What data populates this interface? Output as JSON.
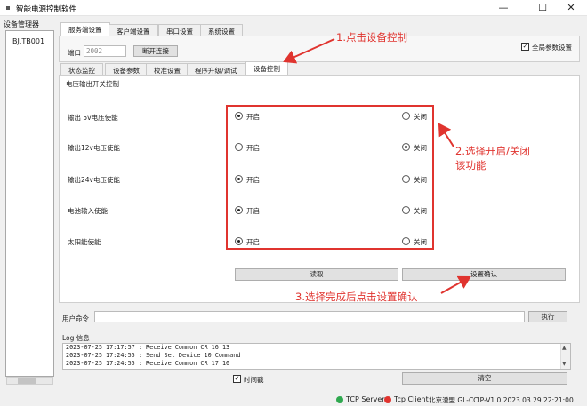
{
  "window": {
    "title": "智能电源控制软件",
    "minimize": "—",
    "maximize": "☐",
    "close": "✕"
  },
  "sidebar": {
    "title": "设备管理器",
    "devices": [
      "BJ.TB001"
    ]
  },
  "main_tabs": [
    {
      "label": "服务端设置",
      "active": true
    },
    {
      "label": "客户端设置",
      "active": false
    },
    {
      "label": "串口设置",
      "active": false
    },
    {
      "label": "系统设置",
      "active": false
    }
  ],
  "server": {
    "port_label": "端口",
    "port_value": "2002",
    "disconnect_label": "断开连接",
    "global_params_label": "全局参数设置",
    "global_params_checked": "✓"
  },
  "sub_tabs": [
    {
      "label": "状态监控",
      "active": false
    },
    {
      "label": "设备参数",
      "active": false
    },
    {
      "label": "校准设置",
      "active": false
    },
    {
      "label": "程序升级/调试",
      "active": false
    },
    {
      "label": "设备控制",
      "active": true
    }
  ],
  "control": {
    "group_title": "电压输出开关控制",
    "on_label": "开启",
    "off_label": "关闭",
    "rows": [
      {
        "label": "输出 5v电压使能",
        "state": "on"
      },
      {
        "label": "输出12v电压使能",
        "state": "off"
      },
      {
        "label": "输出24v电压使能",
        "state": "on"
      },
      {
        "label": "电池输入使能",
        "state": "on"
      },
      {
        "label": "太阳能使能",
        "state": "on"
      }
    ],
    "read_label": "读取",
    "confirm_label": "设置确认"
  },
  "command": {
    "label": "用户命令",
    "value": "",
    "execute_label": "执行"
  },
  "log": {
    "title": "Log 信息",
    "lines": [
      "2023-07-25 17:17:57 : Receive Common CR 16 13",
      "2023-07-25 17:24:55 : Send Set Device 10 Command",
      "2023-07-25 17:24:55 : Receive Common CR 17 10"
    ],
    "timestamp_label": "时间戳",
    "timestamp_checked": "✓",
    "clear_label": "清空"
  },
  "status_bar": {
    "tcp_server": "TCP Server",
    "tcp_client": "Tcp Client",
    "info": "北京澄盟 GL-CCIP-V1.0 2023.03.29 22:21:00",
    "colors": {
      "server": "#2fa84f",
      "client": "#e0342f"
    }
  },
  "annotations": {
    "step1": "1.点击设备控制",
    "step2_line1": "2.选择开启/关闭",
    "step2_line2": "该功能",
    "step3": "3.选择完成后点击设置确认",
    "color": "#e0342f"
  }
}
